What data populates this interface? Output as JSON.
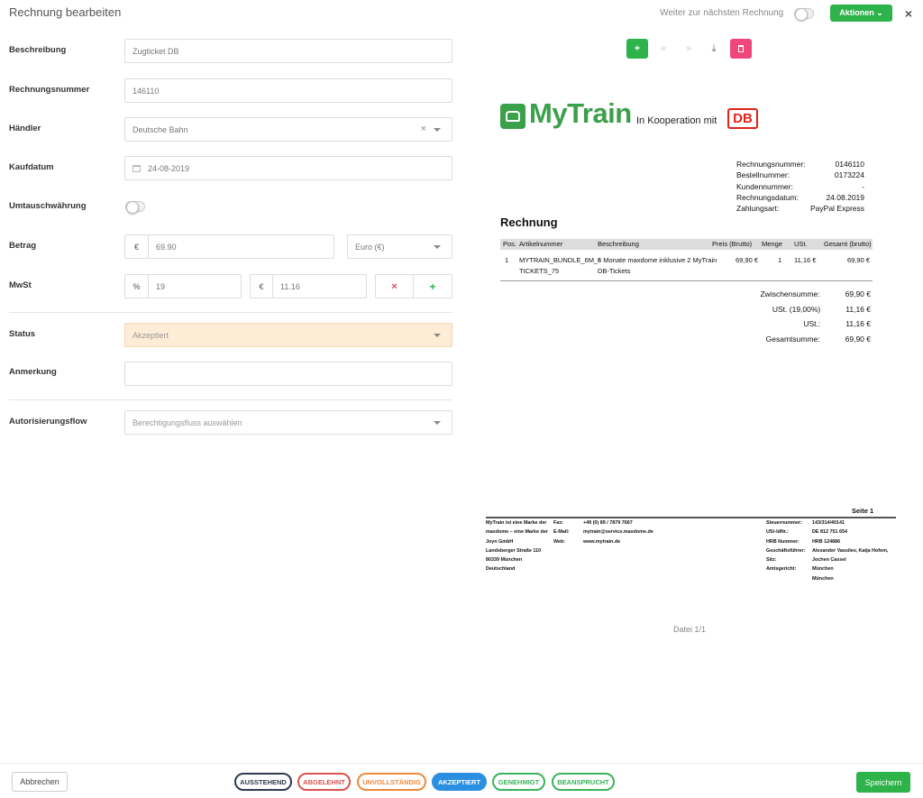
{
  "header": {
    "title": "Rechnung bearbeiten",
    "next_label": "Weiter zur nächsten Rechnung",
    "actions_label": "Aktionen",
    "close_symbol": "×"
  },
  "form": {
    "beschreibung": {
      "label": "Beschreibung",
      "value": "Zugticket DB"
    },
    "rechnungsnummer": {
      "label": "Rechnungsnummer",
      "value": "146110"
    },
    "haendler": {
      "label": "Händler",
      "value": "Deutsche Bahn"
    },
    "kaufdatum": {
      "label": "Kaufdatum",
      "value": "24-08-2019"
    },
    "umtausch": {
      "label": "Umtauschwährung"
    },
    "betrag": {
      "label": "Betrag",
      "prefix": "€",
      "value": "69.90",
      "currency": "Euro (€)"
    },
    "mwst": {
      "label": "MwSt",
      "pct_prefix": "%",
      "pct_value": "19",
      "eur_prefix": "€",
      "eur_value": "11.16"
    },
    "status": {
      "label": "Status",
      "value": "Akzeptiert"
    },
    "anmerkung": {
      "label": "Anmerkung",
      "value": ""
    },
    "autorisierung": {
      "label": "Autorisierungsflow",
      "placeholder": "Berechtigungsfluss auswählen"
    }
  },
  "preview": {
    "logo_text": "MyTrain",
    "cooperation": "In Kooperation mit",
    "db_logo": "DB",
    "meta": [
      {
        "k": "Rechnungsnummer:",
        "v": "0146110"
      },
      {
        "k": "Bestellnummer:",
        "v": "0173224"
      },
      {
        "k": "Kundennummer:",
        "v": "-"
      },
      {
        "k": "Rechnungsdatum:",
        "v": "24.08.2019"
      },
      {
        "k": "Zahlungsart:",
        "v": "PayPal Express"
      }
    ],
    "heading": "Rechnung",
    "columns": [
      "Pos.",
      "Artikelnummer",
      "Beschreibung",
      "Preis (Brutto)",
      "Menge",
      "USt.",
      "Gesamt (brutto)"
    ],
    "row": {
      "pos": "1",
      "art1": "MYTRAIN_BUNDLE_6M_8",
      "art2": "TICKETS_75",
      "desc1": "6 Monate maxdome inklusive 2 MyTrain",
      "desc2": "DB-Tickets",
      "price": "69,90 €",
      "qty": "1",
      "ust": "11,16 €",
      "total": "69,90 €"
    },
    "totals": [
      {
        "k": "Zwischensumme:",
        "v": "69,90 €"
      },
      {
        "k": "USt. (19,00%)",
        "v": "11,16 €"
      },
      {
        "k": "USt.:",
        "v": "11,16 €"
      },
      {
        "k": "Gesamtsumme:",
        "v": "69,90 €"
      }
    ],
    "page_label": "Seite 1",
    "footer_col1": [
      "MyTrain ist eine Marke der",
      "maxdome – eine Marke der",
      "Joyn GmbH",
      "Landsberger Straße 110",
      "80339 München",
      "Deutschland"
    ],
    "footer_col2_keys": [
      "Fax:",
      "E-Mail:",
      "Web:"
    ],
    "footer_col2_vals": [
      "+49 (0) 89 / 7879 7667",
      "mytrain@service.maxdome.de",
      "www.mytrain.de"
    ],
    "footer_col3_keys": [
      "Steuernummer:",
      "USt-IdNr.:",
      "HRB Nummer:",
      "Geschäftsführer:",
      "",
      "Sitz:",
      "Amtsgericht:"
    ],
    "footer_col3_vals": [
      "143/314/40141",
      "DE 812 751 654",
      "HRB 124886",
      "Alexander Vassilev, Katja Hofem,",
      "Jochen Cassel",
      "München",
      "München"
    ],
    "file_label": "Datei 1/1"
  },
  "bottom": {
    "cancel": "Abbrechen",
    "statuses": [
      {
        "label": "AUSSTEHEND",
        "color": "#2f3b4c"
      },
      {
        "label": "ABGELEHNT",
        "color": "#d9534f"
      },
      {
        "label": "UNVOLLSTÄNDIG",
        "color": "#f0893a"
      },
      {
        "label": "AKZEPTIERT",
        "color": "#2a8fe0"
      },
      {
        "label": "GENEHMIGT",
        "color": "#3bb35a"
      },
      {
        "label": "BEANSPRUCHT",
        "color": "#3bb35a"
      }
    ],
    "save": "Speichern"
  },
  "colors": {
    "accent": "#2eb24a",
    "danger": "#f0467b",
    "status_bg": "#fdecd6"
  }
}
